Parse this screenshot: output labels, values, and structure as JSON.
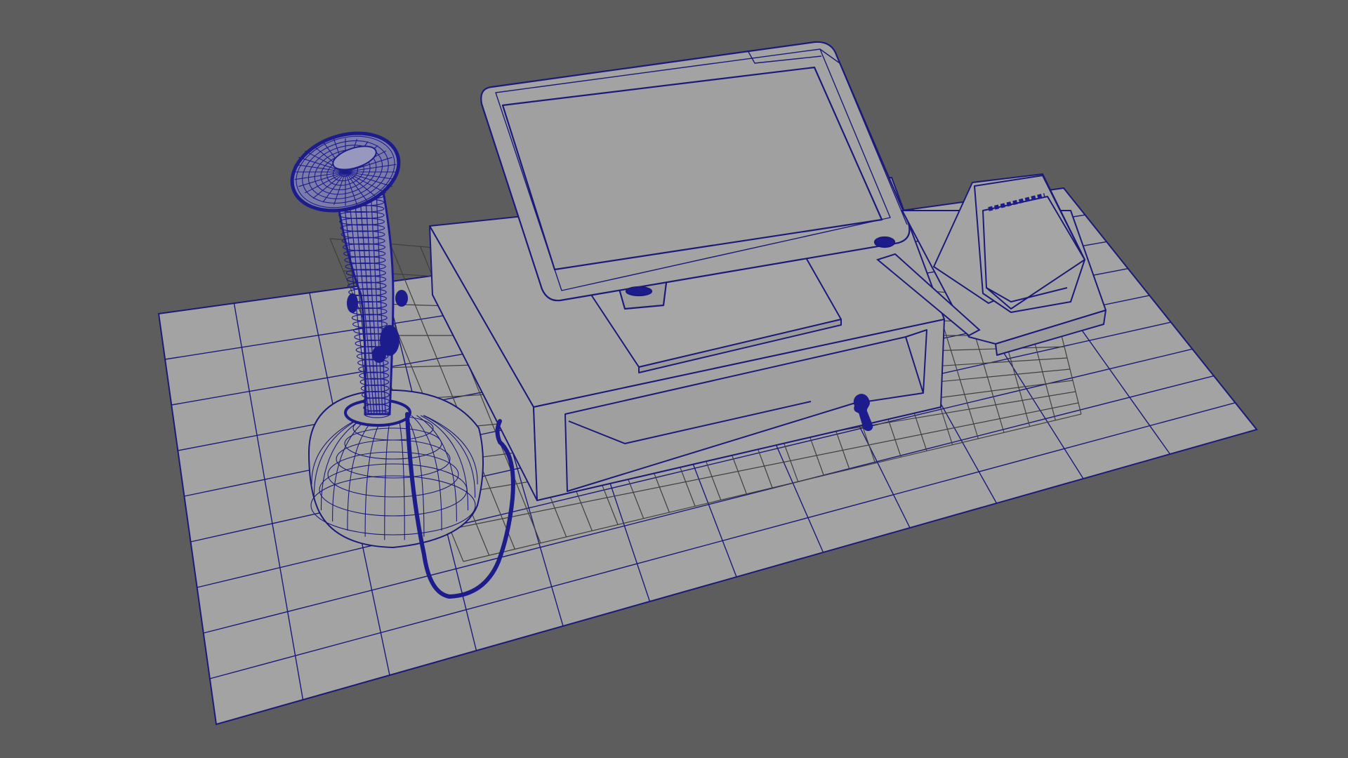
{
  "viewport": {
    "mode": "wireframe-on-shaded",
    "view": "perspective",
    "background_color": "#5d5d5d",
    "surface_color": "#a3a3a3",
    "wire_color": "#1a1a7a",
    "selected_wire_color": "#1c1c8c",
    "grid_color": "#444444"
  },
  "scene": {
    "objects": [
      {
        "name": "ground-plane-mesh",
        "kind": "plane",
        "selected": false
      },
      {
        "name": "handheld-scanner-mesh",
        "kind": "scanner-on-stand",
        "selected": true
      },
      {
        "name": "pos-monitor-mesh",
        "kind": "touchscreen-display",
        "selected": false
      },
      {
        "name": "cash-drawer-mesh",
        "kind": "cash-drawer",
        "selected": false
      },
      {
        "name": "receipt-printer-mesh",
        "kind": "receipt-printer",
        "selected": false
      },
      {
        "name": "scanner-cable-mesh",
        "kind": "cable",
        "selected": true
      }
    ]
  }
}
